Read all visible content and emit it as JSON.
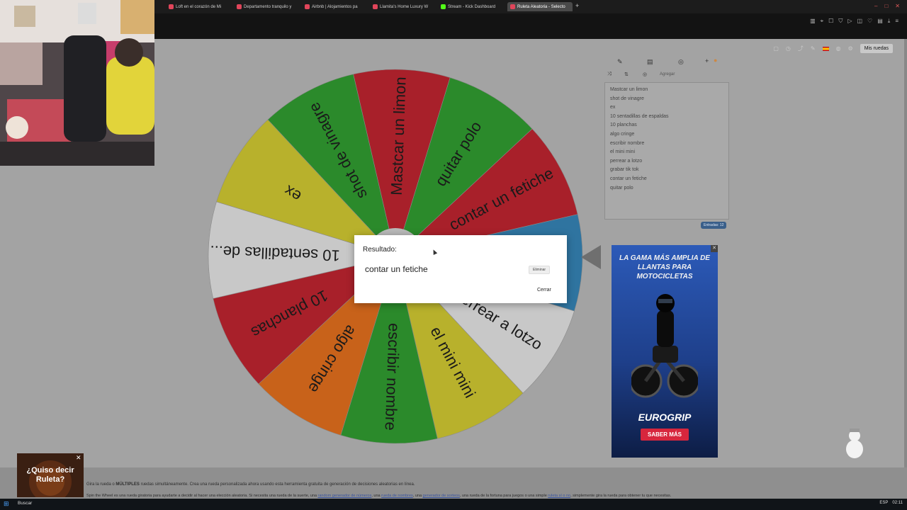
{
  "browser": {
    "tabs": [
      {
        "label": "Loft en el corazón de Mi",
        "active": false
      },
      {
        "label": "Departamento tranquilo y",
        "active": false
      },
      {
        "label": "Airbnb | Alojamientos pa",
        "active": false
      },
      {
        "label": "Llamita's Home Luxury W",
        "active": false
      },
      {
        "label": "Stream - Kick Dashboard",
        "active": false
      },
      {
        "label": "Ruleta Aleatoria - Selecto",
        "active": true
      }
    ]
  },
  "header": {
    "mine_button": "Mis ruedas"
  },
  "toolbar": {
    "add_label": "Agregar"
  },
  "wheel": {
    "segments": [
      {
        "label": "Mastcar un limon",
        "color": "#a8202a"
      },
      {
        "label": "quitar polo",
        "color": "#2b8a2b"
      },
      {
        "label": "contar un fetiche",
        "color": "#a8202a"
      },
      {
        "label": "grabar tik tok",
        "color": "#2f74a0"
      },
      {
        "label": "perrear a lotzo",
        "color": "#c8c8c8"
      },
      {
        "label": "el mini mini",
        "color": "#b8b12c"
      },
      {
        "label": "escribir nombre",
        "color": "#2b8a2b"
      },
      {
        "label": "algo cringe",
        "color": "#c8621a"
      },
      {
        "label": "10 planchas",
        "color": "#a8202a"
      },
      {
        "label": "10 sentadillas de...",
        "color": "#c8c8c8"
      },
      {
        "label": "ex",
        "color": "#b8b12c"
      },
      {
        "label": "shot de vinagre",
        "color": "#2b8a2b"
      }
    ]
  },
  "entries": [
    "Mastcar un limon",
    "shot de vinagre",
    "ex",
    "10 sentadillas de espaldas",
    "10 planchas",
    "algo cringe",
    "escribir nombre",
    "el mini mini",
    "perrear a lotzo",
    "grabar tik tok",
    "contar un fetiche",
    "quitar polo"
  ],
  "entries_count": "Entradas: 12",
  "dialog": {
    "title": "Resultado:",
    "result": "contar un fetiche",
    "remove_label": "Eliminar",
    "close_label": "Cerrar"
  },
  "ad": {
    "headline": "LA GAMA MÁS AMPLIA DE LLANTAS PARA MOTOCICLETAS",
    "brand": "EUROGRIP",
    "cta": "SABER MÁS"
  },
  "footer": {
    "line1_prefix": "Gira la rueda o ",
    "line1_bold": "MÚLTIPLES",
    "line1_suffix": " ruedas simultáneamente. Crea una rueda personalizada ahora usando esta herramienta gratuita de generación de decisiones aleatorias en línea.",
    "line2_a": "Spin the Wheel es una rueda giratoria para ayudarte a decidir al hacer una elección aleatoria. Si necesita una rueda de la suerte, una ",
    "link1": "random generador de números",
    "line2_b": ", una ",
    "link2": "rueda de nombres",
    "line2_c": ", una ",
    "link3": "generador de sorteos",
    "line2_d": ", una rueda de la fortuna para juegos o una simple ",
    "link4": "ruleta sí o no",
    "line2_e": ", simplemente gira la rueda para obtener tu que necesitas."
  },
  "promo": {
    "text": "¿Quiso decir Ruleta?"
  },
  "taskbar": {
    "search": "Buscar",
    "lang": "ESP",
    "time": "02:11"
  }
}
